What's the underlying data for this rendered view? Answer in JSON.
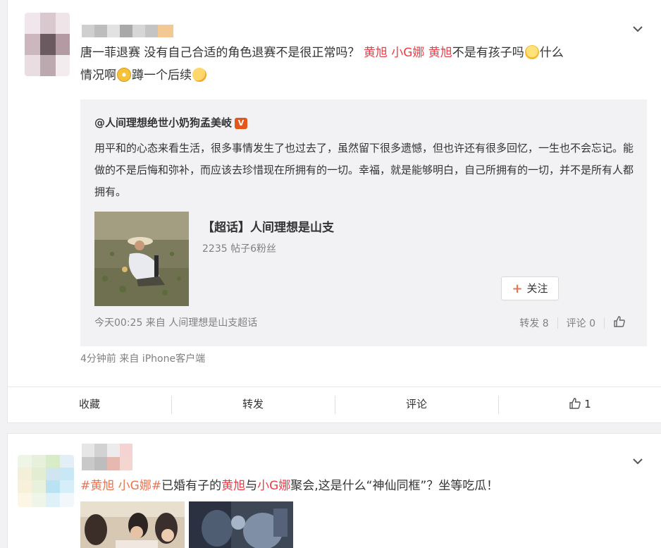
{
  "post1": {
    "author_name": "",
    "text_before": "唐一菲退赛 没有自己合适的角色退赛不是很正常吗？ ",
    "mention1": "黄旭 小G娜 黄旭",
    "text_mid": "不是有孩子吗",
    "text_line2a": "什么",
    "text_line2b": "情况啊",
    "text_line2c": "蹲一个后续",
    "quote": {
      "author": "@人间理想绝世小奶狗孟美岐",
      "badge": "V",
      "body": "用平和的心态来看生活，很多事情发生了也过去了，虽然留下很多遗憾，但也许还有很多回忆，一生也不会忘记。能做的不是后悔和弥补，而应该去珍惜现在所拥有的一切。幸福，就是能够明白，自己所拥有的一切，并不是所有人都拥有。",
      "topic_title": "【超话】人间理想是山支",
      "topic_stats": "2235 帖子6粉丝",
      "follow_label": "关注",
      "meta": "今天00:25 来自 人间理想是山支超话",
      "repost": "转发 8",
      "comment": "评论 0"
    },
    "meta": "4分钟前  来自 iPhone客户端",
    "actions": {
      "favorite": "收藏",
      "repost": "转发",
      "comment": "评论",
      "like_count": "1"
    }
  },
  "post2": {
    "author_name": "",
    "tag": "#黄旭 小G娜#",
    "text_a": "已婚有子的",
    "name1": "黄旭",
    "text_b": "与",
    "name2": "小G娜",
    "text_c": "聚会,这是什么“神仙同框”？坐等吃瓜！"
  },
  "colors": {
    "accent": "#eb7350",
    "highlight": "#eb3d48",
    "meta_gray": "#808080",
    "quote_bg": "#f2f2f5"
  },
  "icons": {
    "chevron": "chevron-down-icon",
    "like": "thumbs-up-icon",
    "plus": "plus-icon"
  }
}
